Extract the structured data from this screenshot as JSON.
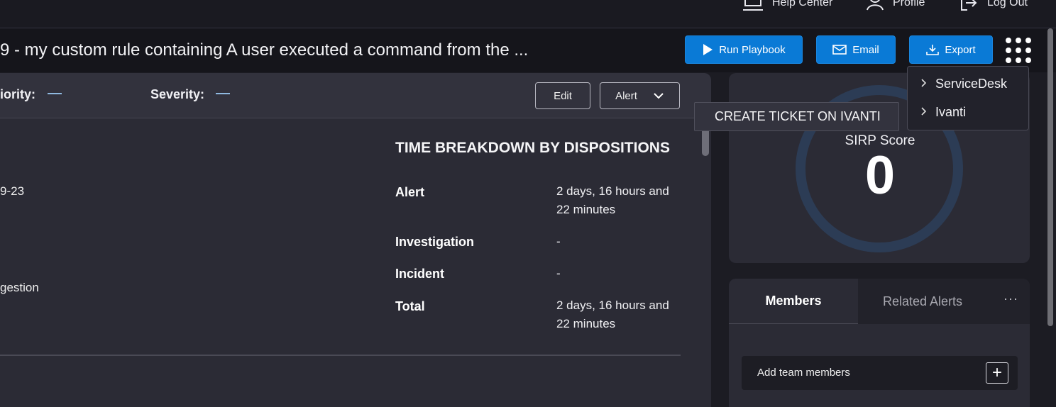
{
  "topnav": {
    "help_center": "Help Center",
    "profile": "Profile",
    "logout": "Log Out"
  },
  "header": {
    "title": "9 - my custom rule containing A user executed a command from the ...",
    "run_playbook": "Run Playbook",
    "email": "Email",
    "export": "Export"
  },
  "panel": {
    "priority_label": "iority:",
    "severity_label": "Severity:",
    "edit": "Edit",
    "alert_select": "Alert",
    "left_values": [
      "9-23",
      "gestion"
    ],
    "time_breakdown": {
      "title": "TIME BREAKDOWN BY DISPOSITIONS",
      "rows": [
        {
          "label": "Alert",
          "value": "2 days, 16 hours and 22 minutes"
        },
        {
          "label": "Investigation",
          "value": "-"
        },
        {
          "label": "Incident",
          "value": "-"
        },
        {
          "label": "Total",
          "value": "2 days, 16 hours and 22 minutes"
        }
      ]
    }
  },
  "sirp": {
    "label": "SIRP Score",
    "score": "0"
  },
  "export_menu": {
    "items": [
      "ServiceDesk",
      "Ivanti"
    ],
    "submenu_action": "CREATE TICKET ON IVANTI"
  },
  "members_card": {
    "tab_members": "Members",
    "tab_related": "Related Alerts",
    "more": "···",
    "add_members": "Add team members",
    "plus": "+"
  },
  "colors": {
    "accent_blue": "#0a7ad6",
    "background": "#1c1c23",
    "panel": "#2b2b35"
  }
}
